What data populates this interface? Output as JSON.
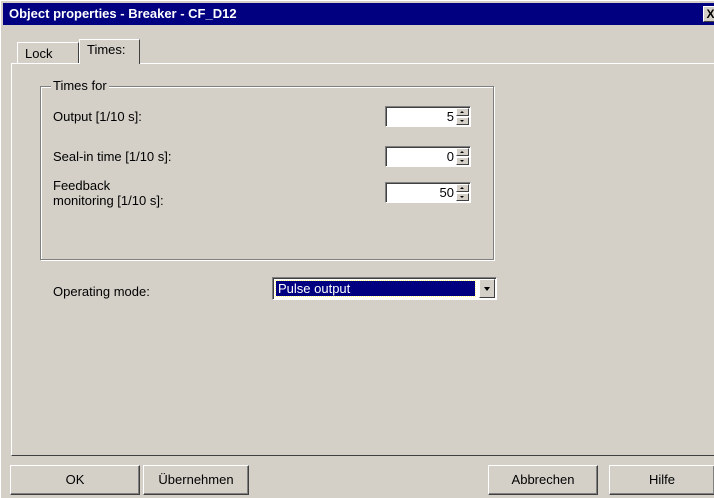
{
  "window": {
    "title": "Object properties - Breaker - CF_D12",
    "close_glyph": "X"
  },
  "tabs": [
    {
      "label": "Lock",
      "active": false
    },
    {
      "label": "Times:",
      "active": true
    }
  ],
  "group": {
    "legend": "Times for",
    "fields": [
      {
        "label": "Output [1/10 s]:",
        "value": "5"
      },
      {
        "label": "Seal-in time [1/10 s]:",
        "value": "0"
      },
      {
        "label_line1": "Feedback",
        "label_line2": "monitoring [1/10 s]:",
        "value": "50"
      }
    ]
  },
  "operating_mode": {
    "label": "Operating mode:",
    "selected": "Pulse output"
  },
  "buttons": {
    "ok": "OK",
    "apply": "Übernehmen",
    "cancel": "Abbrechen",
    "help": "Hilfe"
  },
  "colors": {
    "face": "#d4d0c8",
    "titlebar": "#000080",
    "selection": "#000080"
  }
}
